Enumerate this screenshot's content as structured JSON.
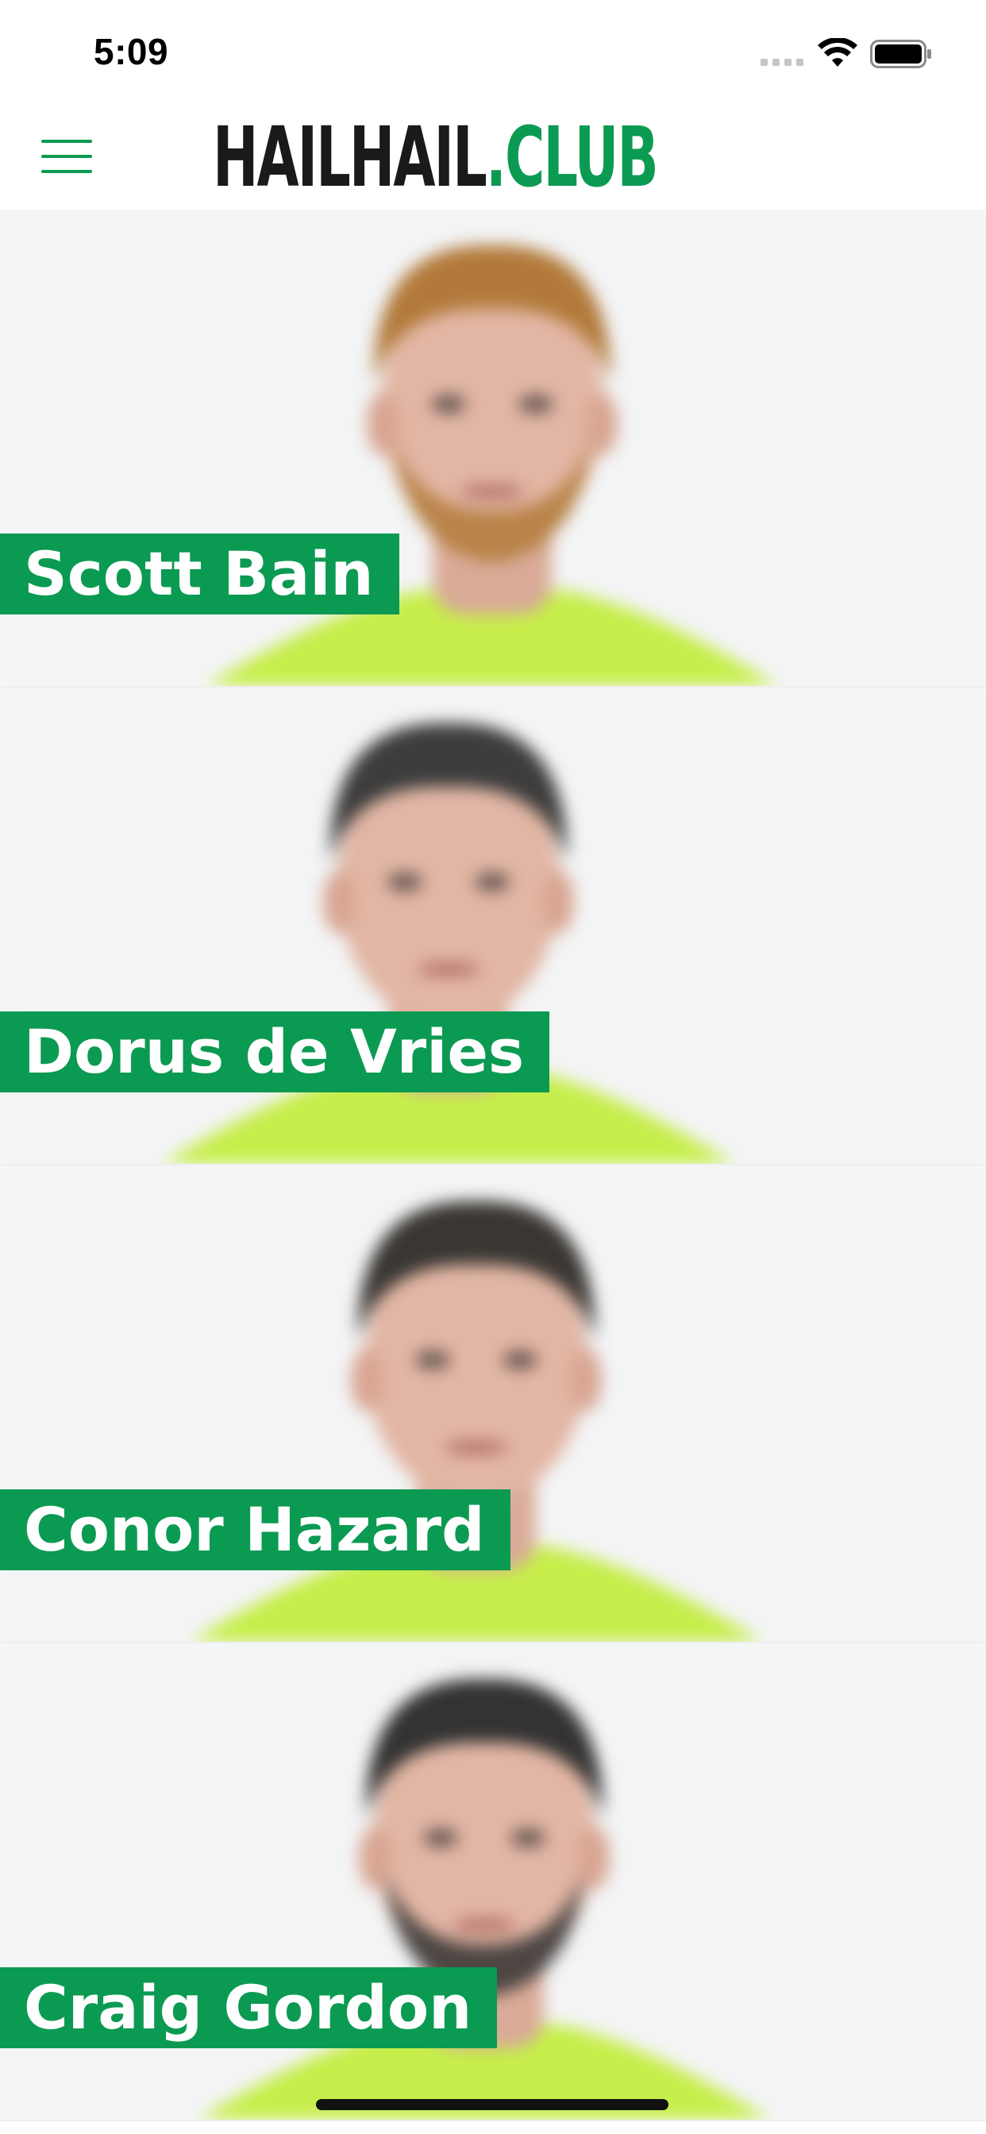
{
  "status_bar": {
    "time": "5:09",
    "icons": [
      "cellular-signal-icon",
      "wifi-icon",
      "battery-icon"
    ]
  },
  "header": {
    "menu_icon": "hamburger-menu-icon",
    "logo": {
      "part1": "HAILHAIL",
      "part2": ".CLUB"
    }
  },
  "colors": {
    "brand_green": "#0b9a52",
    "kit_green": "#c6ee4a",
    "text_dark": "#1a1a1a"
  },
  "players": [
    {
      "name": "Scott Bain",
      "hair": "#b27a3a",
      "beard": true
    },
    {
      "name": "Dorus de Vries",
      "hair": "#3d3d3d",
      "beard": false
    },
    {
      "name": "Conor Hazard",
      "hair": "#3a3733",
      "beard": false
    },
    {
      "name": "Craig Gordon",
      "hair": "#333333",
      "beard": true
    }
  ]
}
